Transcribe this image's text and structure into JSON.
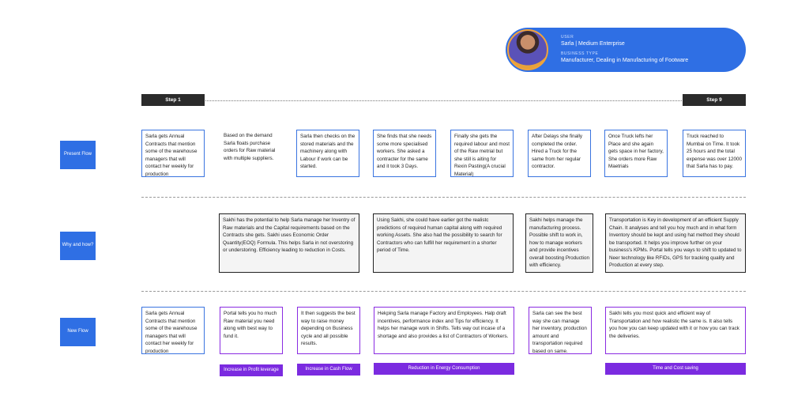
{
  "user": {
    "user_label": "USER",
    "user_value": "Sarla | Medium Enterprise",
    "business_label": "BUSINESS TYPE",
    "business_value": "Manufacturer, Dealing in Manufacturing of Footware"
  },
  "steps": {
    "start": "Step 1",
    "end": "Step 9"
  },
  "rows": {
    "present": "Present Flow",
    "why": "Why and how?",
    "new": "New Flow"
  },
  "present_flow": [
    "Sarla gets Annual Contracts that mention some of the warehouse managers that will contact her weekly for production",
    "Based on the demand Sarla floats purchase orders for Raw material with multiple suppliers.",
    "Sarla then checks on the stored materials and the machinery along with Labour if work can be started.",
    "She finds that she needs some more specialised workers. She asked a contracter for the same and it took 3 Days.",
    "Finally she gets the required labour and most of the Raw metrial but she still is aiting for Rexin Pasting(A crucial Material)",
    "After Delays she finally completed the order. Hired a Truck for the same from her regular contractor.",
    "Once Truck lefts her Place and she again gets space in her factory, She orders more Raw Maetrials",
    "Truck reached to Mumbai on Time. It took 25 hours and the total expense was over 12000 that Sarla has to pay."
  ],
  "why_how": [
    "Sakhi has the potential to help Sarla manage her Inventry of Raw materials and the Capital requirements based on the Contracts she gets.  Sakhi uses Economic Order Quantity(EOQ) Formula. This helps Sarla in not overstoring or understoring. Efficiency leading to reduction in Costs.",
    "Using Sakhi, she could have earlier got the realistc predictions of required human capital along with required working Assets. She also had the possibility to search for Contractors who can fulfill her requirement in a shorter period of Time.",
    "Sakhi helps manage the manufacturing process. Possible shift to work in, how to manage workers and provide incentives overall boosting Production with efficiency.",
    "Transportation is Key in development of an efficient Supply Chain. It analyses and tell you hoy much and in what form Inventory should be kept and using hat method they should be transported. It helps you improve further on your business's KPMs. Portal tells you ways to shift to updated to Neer technology like RFIDs, GPS for tracking quality and Production at every step."
  ],
  "new_flow": [
    "Sarla gets Annual Contracts that mention some of the warehouse managers that will contact her weekly for production",
    "Portal tells you ho much Raw material you need along with best way to fund it.",
    "It then suggests the best way to raise money depending on Business cycle and all possible results.",
    "Hekping Sarla manage Factory and Employees. Halp draft incentives, performance index and Tips for efficiency. It helps her manage work in Shifts. Tells way out incase of a shortage and also provides a list of Contractors of Workers.",
    "Sarla can see the best way she can manage her inventory, production amount and transportation required based on same.",
    "Sakhi tells you most quick and efficient way of Transportation and how realistic the same is. It also tells you how you can keep updated with it or how you can track the deliveries."
  ],
  "badges": [
    "Increase in Profit leverage",
    "Increase in Cash Flow",
    "Reduction in Energy Consumption",
    "Time and Cost saving"
  ]
}
